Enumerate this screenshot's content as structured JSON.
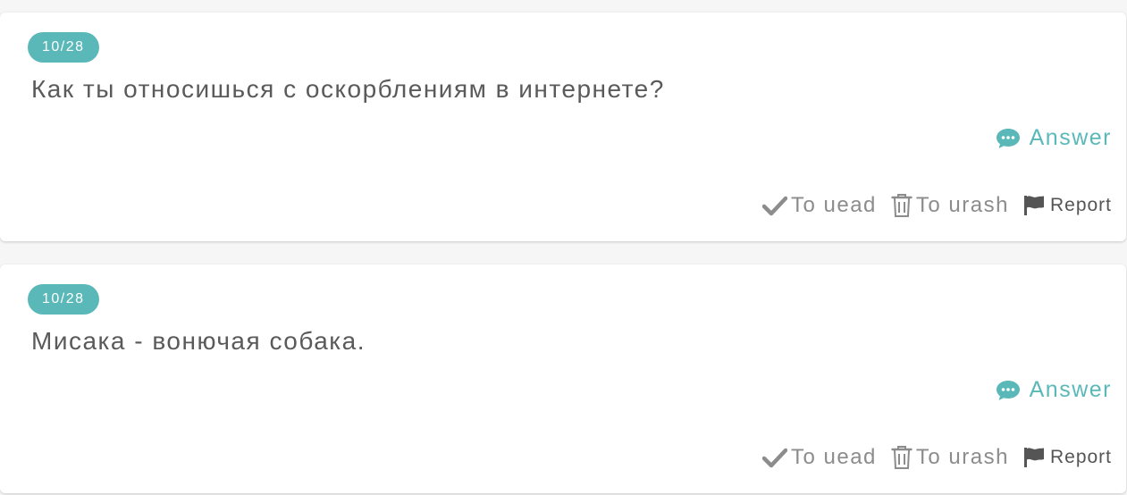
{
  "colors": {
    "accent": "#5bb8b8",
    "question_text": "#5a5a5a",
    "action_text": "#8c8c8c",
    "report_text": "#555555",
    "background": "#f6f6f6"
  },
  "posts": [
    {
      "date": "10/28",
      "question": "Как ты относишься с оскорблениям в интернете?",
      "answer_label": "Answer",
      "answer_icon": "speech-bubble-icon",
      "actions": [
        {
          "label": "To uead",
          "icon": "checkmark-icon"
        },
        {
          "label": "To urash",
          "icon": "trash-icon"
        },
        {
          "label": "Report",
          "icon": "flag-icon"
        }
      ]
    },
    {
      "date": "10/28",
      "question": "Мисака - вонючая собака.",
      "answer_label": "Answer",
      "answer_icon": "speech-bubble-icon",
      "actions": [
        {
          "label": "To uead",
          "icon": "checkmark-icon"
        },
        {
          "label": "To urash",
          "icon": "trash-icon"
        },
        {
          "label": "Report",
          "icon": "flag-icon"
        }
      ]
    }
  ]
}
